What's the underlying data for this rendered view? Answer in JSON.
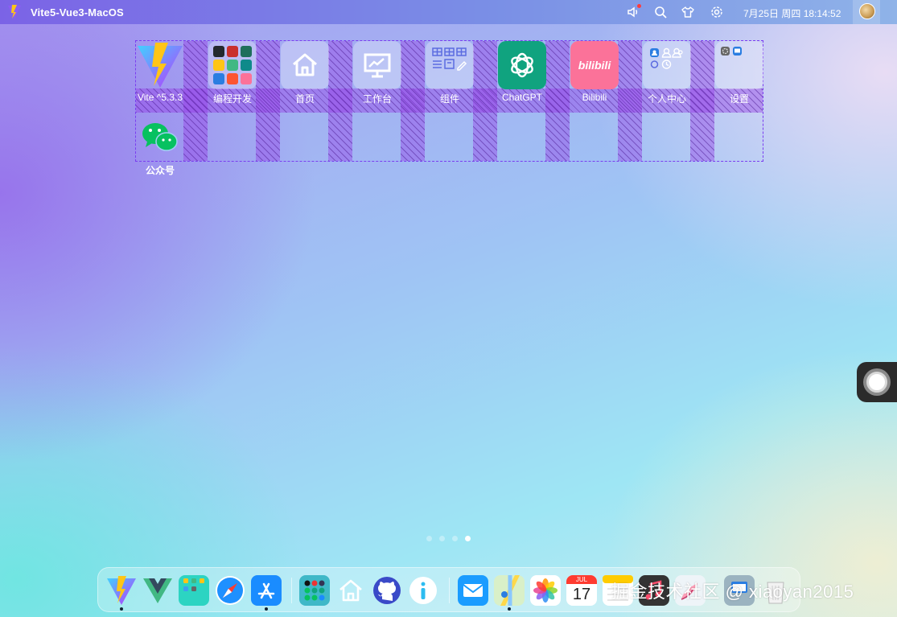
{
  "topbar": {
    "app_title": "Vite5-Vue3-MacOS",
    "clock": "7月25日 周四 18:14:52",
    "icons": [
      "speaker-icon",
      "search-icon",
      "shirt-icon",
      "gear-icon"
    ]
  },
  "desktop": {
    "apps": [
      {
        "label": "Vite ^5.3.3",
        "icon": "vite-icon"
      },
      {
        "label": "编程开发",
        "icon": "folder-icon"
      },
      {
        "label": "首页",
        "icon": "home-icon"
      },
      {
        "label": "工作台",
        "icon": "workbench-icon"
      },
      {
        "label": "组件",
        "icon": "components-icon"
      },
      {
        "label": "ChatGPT",
        "icon": "chatgpt-icon"
      },
      {
        "label": "Bilibili",
        "icon": "bilibili-icon"
      },
      {
        "label": "个人中心",
        "icon": "user-center-icon"
      },
      {
        "label": "设置",
        "icon": "settings-icon"
      },
      {
        "label": "公众号",
        "icon": "wechat-icon"
      }
    ],
    "bilibili_text": "bilibili"
  },
  "pagination": {
    "pages": 4,
    "active": 4
  },
  "dock": {
    "items": [
      "vite-icon",
      "vue-icon",
      "launchpad-icon",
      "safari-icon",
      "app-store-icon",
      "app-folder-icon",
      "home-icon",
      "github-icon",
      "info-icon",
      "mail-icon",
      "maps-icon",
      "photos-icon",
      "calendar-icon",
      "notes-icon",
      "music-icon",
      "appearance-icon",
      "trash-icon"
    ],
    "calendar_month": "JUL",
    "calendar_day": "17"
  },
  "watermark": "掘金技术社区 @ xiaoyan2015",
  "colors": {
    "accent": "#7b63e6",
    "grid_border": "#7a3df0",
    "chatgpt_green": "#10a37f",
    "bilibili_pink": "#fb7299"
  }
}
